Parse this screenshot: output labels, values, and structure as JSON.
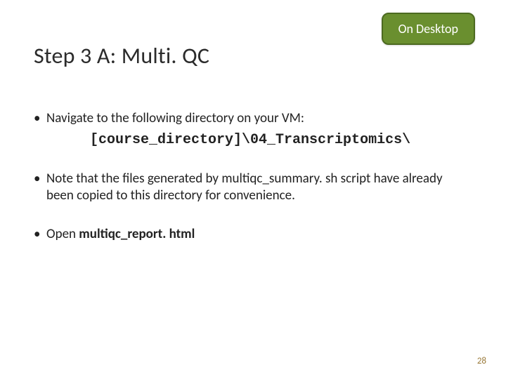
{
  "badge": {
    "label": "On Desktop"
  },
  "title": "Step 3 A: Multi. QC",
  "bullets": {
    "b1": {
      "text": "Navigate to the following directory on your VM:",
      "code": "[course_directory]\\04_Transcriptomics\\"
    },
    "b2": {
      "text_a": "Note that the files generated by multiqc_summary. sh script have already been copied to this directory for convenience."
    },
    "b3": {
      "text_a": "Open ",
      "filename": "multiqc_report. html"
    }
  },
  "page_number": "28"
}
